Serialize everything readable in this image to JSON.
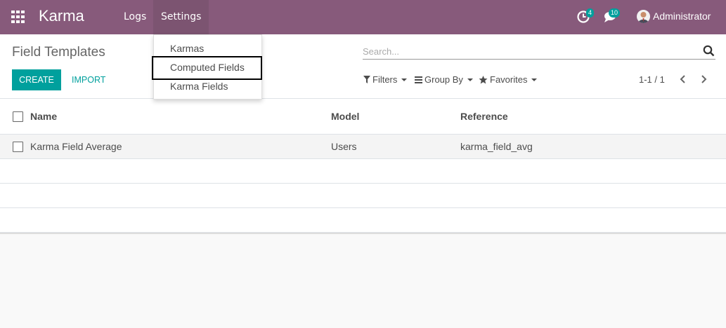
{
  "navbar": {
    "brand": "Karma",
    "menus": [
      "Logs",
      "Settings"
    ],
    "activity_count": "4",
    "chat_count": "10",
    "user_name": "Administrator",
    "bg_color": "#875a7b",
    "accent_color": "#00a09d"
  },
  "settings_menu": {
    "items": [
      "Karmas",
      "Computed Fields",
      "Karma Fields"
    ],
    "highlighted": "Computed Fields"
  },
  "control_panel": {
    "title": "Field Templates",
    "create_label": "CREATE",
    "import_label": "IMPORT",
    "search_placeholder": "Search...",
    "filters_label": "Filters",
    "groupby_label": "Group By",
    "favorites_label": "Favorites",
    "pager": "1-1 / 1"
  },
  "table": {
    "columns": [
      "Name",
      "Model",
      "Reference"
    ],
    "rows": [
      [
        "Karma Field Average",
        "Users",
        "karma_field_avg"
      ]
    ]
  }
}
